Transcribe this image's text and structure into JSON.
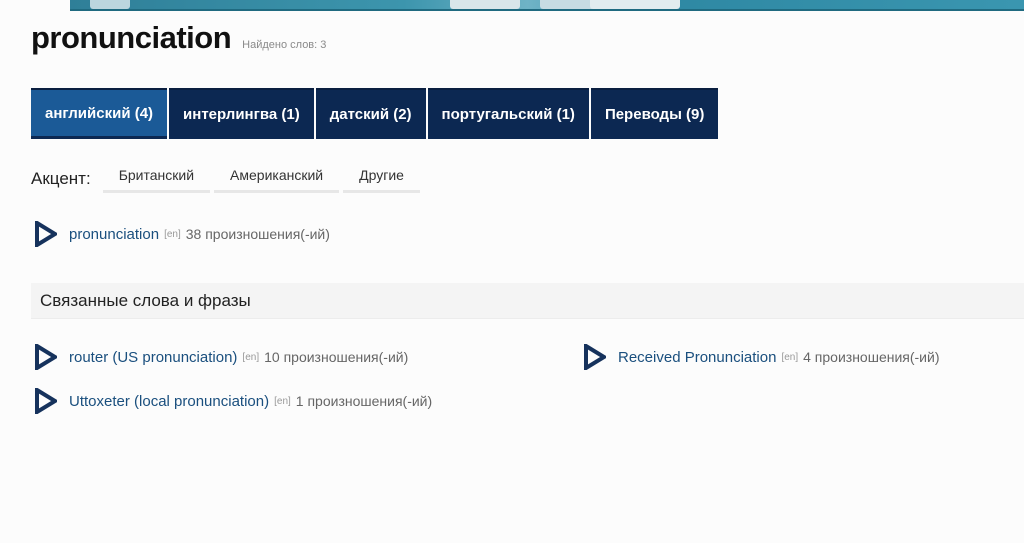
{
  "header": {
    "title": "pronunciation",
    "found_label": "Найдено слов: 3"
  },
  "tabs": [
    {
      "label": "английский (4)",
      "active": true
    },
    {
      "label": "интерлингва (1)",
      "active": false
    },
    {
      "label": "датский (2)",
      "active": false
    },
    {
      "label": "португальский (1)",
      "active": false
    },
    {
      "label": "Переводы (9)",
      "active": false
    }
  ],
  "accent": {
    "label": "Акцент:",
    "options": [
      "Британский",
      "Американский",
      "Другие"
    ]
  },
  "main_entry": {
    "word": "pronunciation",
    "lang": "[en]",
    "count": "38 произношения(-ий)"
  },
  "related": {
    "title": "Связанные слова и фразы",
    "items": [
      {
        "word": "router (US pronunciation)",
        "lang": "[en]",
        "count": "10 произношения(-ий)"
      },
      {
        "word": "Received Pronunciation",
        "lang": "[en]",
        "count": "4 произношения(-ий)"
      },
      {
        "word": "Uttoxeter (local pronunciation)",
        "lang": "[en]",
        "count": "1 произношения(-ий)"
      }
    ]
  },
  "colors": {
    "tab_bg": "#0c2852",
    "tab_active_bg": "#1b5a97",
    "link": "#1a4f7e",
    "play_icon": "#16325c"
  },
  "icons": {
    "play": "play-triangle-icon"
  }
}
